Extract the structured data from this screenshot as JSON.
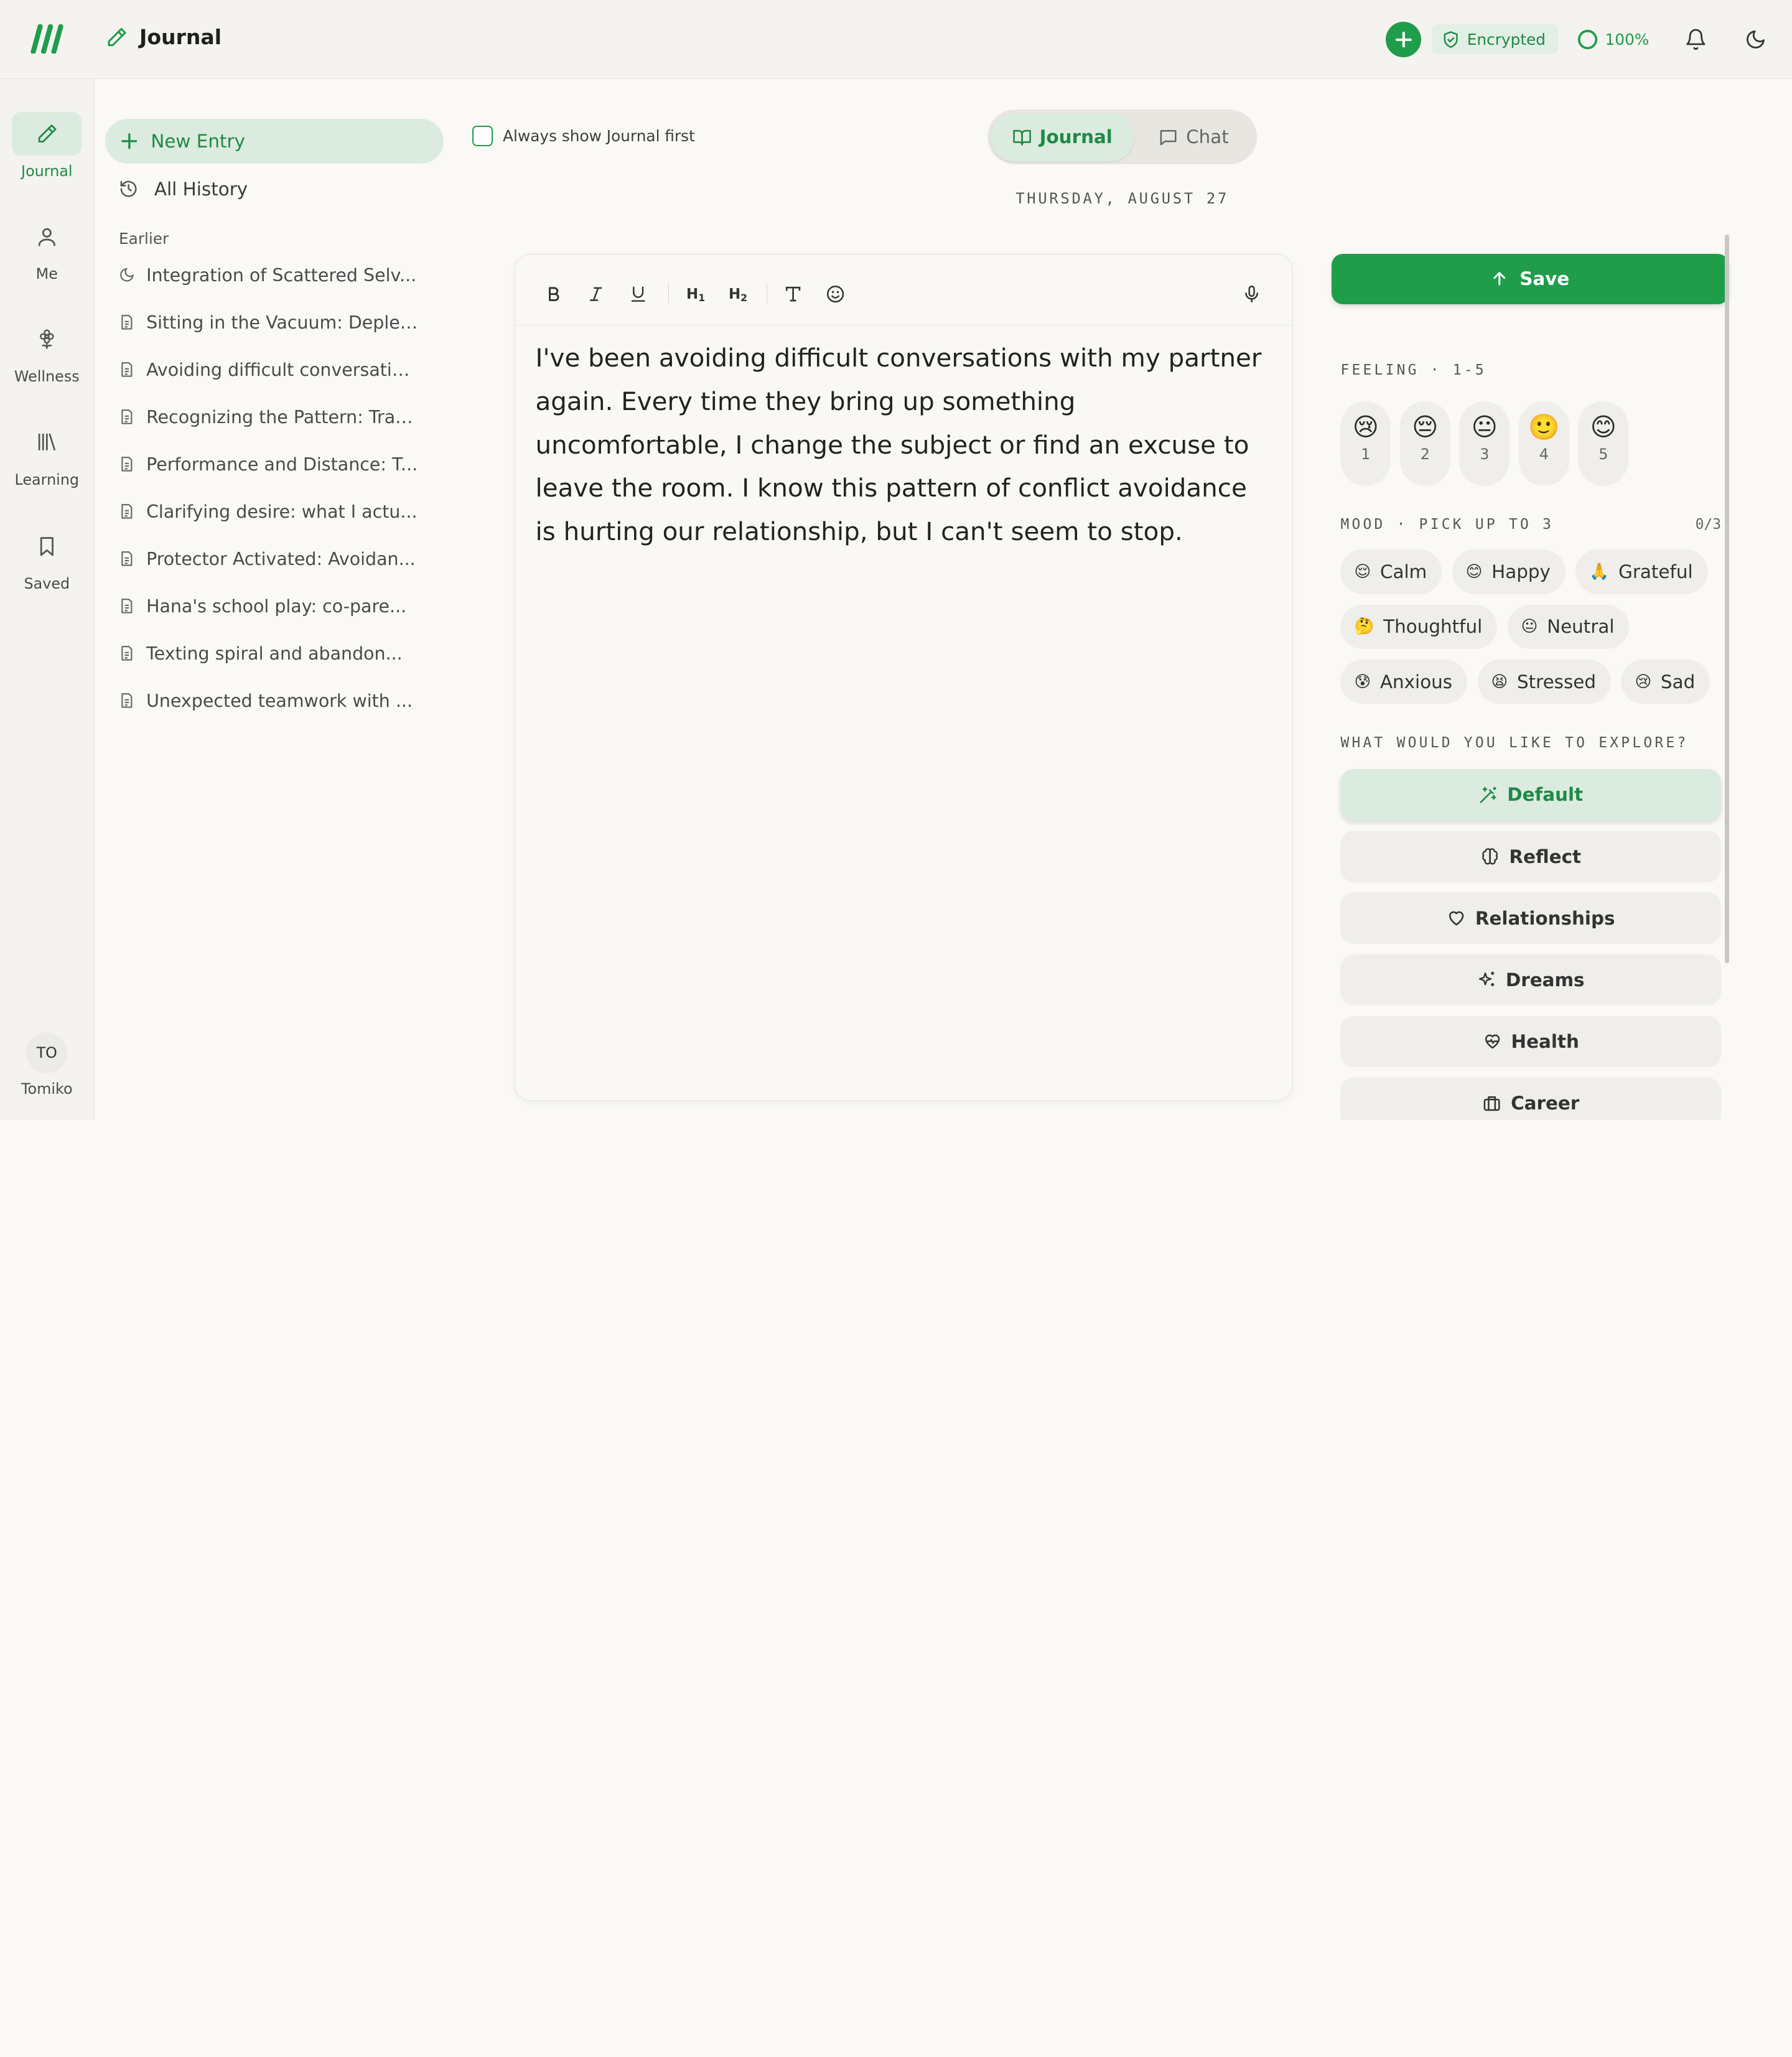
{
  "app": {
    "title": "Journal",
    "brand_color": "#1f9d4b",
    "accent_bg": "#dcebdf"
  },
  "topbar": {
    "encrypted_label": "Encrypted",
    "battery_label": "100%"
  },
  "rail": {
    "items": [
      {
        "label": "Journal",
        "icon": "pencil-icon",
        "active": true
      },
      {
        "label": "Me",
        "icon": "person-icon"
      },
      {
        "label": "Wellness",
        "icon": "flower-icon"
      },
      {
        "label": "Learning",
        "icon": "library-icon"
      },
      {
        "label": "Saved",
        "icon": "bookmark-icon"
      }
    ],
    "user": {
      "initials": "TO",
      "name": "Tomiko"
    }
  },
  "sidebar": {
    "new_entry": "New Entry",
    "all_history": "All History",
    "section_label": "Earlier",
    "entries": [
      "Integration of Scattered Selv...",
      "Sitting in the Vacuum: Deplet...",
      "Avoiding difficult conversatio...",
      "Recognizing the Pattern: Trac...",
      "Performance and Distance: T...",
      "Clarifying desire: what I actu...",
      "Protector Activated: Avoidan...",
      "Hana's school play: co-pare...",
      "Texting spiral and abandon...",
      "Unexpected teamwork with ..."
    ]
  },
  "main": {
    "always_show_label": "Always show Journal first",
    "always_show_checked": false,
    "tabs": [
      {
        "label": "Journal",
        "active": true
      },
      {
        "label": "Chat",
        "active": false
      }
    ],
    "date": "THURSDAY, AUGUST 27",
    "toolbar": {
      "h1": "H",
      "h1_sub": "1",
      "h2": "H",
      "h2_sub": "2"
    },
    "entry_text": "I've been avoiding difficult conversations with my partner again. Every time they bring up something uncomfortable, I change the subject or find an excuse to leave the room. I know this pattern of conflict avoidance is hurting our relationship, but I can't seem to stop."
  },
  "panel": {
    "save_label": "Save",
    "feeling_label": "FEELING · 1-5",
    "feelings": [
      {
        "emoji": "😢",
        "value": "1"
      },
      {
        "emoji": "😔",
        "value": "2"
      },
      {
        "emoji": "😐",
        "value": "3"
      },
      {
        "emoji": "🙂",
        "value": "4"
      },
      {
        "emoji": "😊",
        "value": "5"
      }
    ],
    "mood_label": "MOOD · PICK UP TO 3",
    "mood_count": "0/3",
    "moods": [
      {
        "emoji": "😌",
        "label": "Calm"
      },
      {
        "emoji": "😊",
        "label": "Happy"
      },
      {
        "emoji": "🙏",
        "label": "Grateful"
      },
      {
        "emoji": "🤔",
        "label": "Thoughtful"
      },
      {
        "emoji": "😐",
        "label": "Neutral"
      },
      {
        "emoji": "😰",
        "label": "Anxious"
      },
      {
        "emoji": "😫",
        "label": "Stressed"
      },
      {
        "emoji": "😢",
        "label": "Sad"
      }
    ],
    "explore_label": "WHAT WOULD YOU LIKE TO EXPLORE?",
    "explore": [
      {
        "label": "Default",
        "icon": "wand-icon",
        "active": true
      },
      {
        "label": "Reflect",
        "icon": "brain-icon"
      },
      {
        "label": "Relationships",
        "icon": "heart-icon"
      },
      {
        "label": "Dreams",
        "icon": "sparkles-icon"
      },
      {
        "label": "Health",
        "icon": "heart-pulse-icon"
      },
      {
        "label": "Career",
        "icon": "briefcase-icon"
      }
    ]
  }
}
